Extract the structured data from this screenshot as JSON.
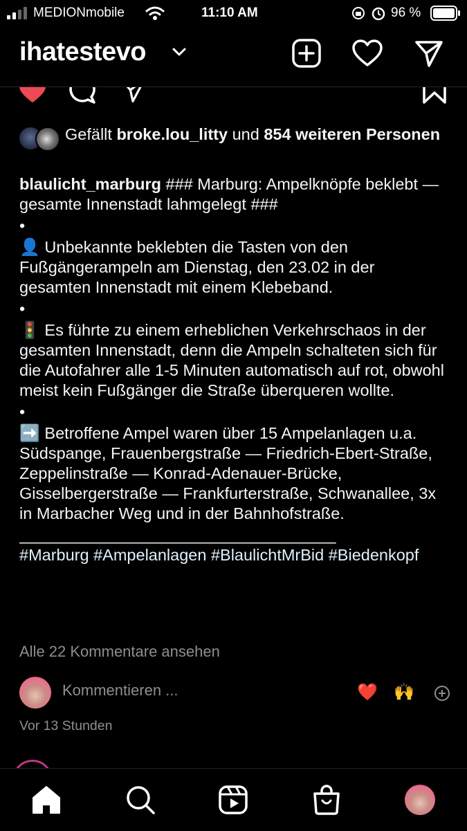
{
  "status_bar": {
    "carrier": "MEDIONmobile",
    "time": "11:10 AM",
    "battery": "96 %"
  },
  "header": {
    "account_name": "ihatestevo"
  },
  "post": {
    "likes": {
      "prefix": "Gefällt ",
      "user": "broke.lou_litty",
      "middle": " und ",
      "count": "854 weiteren Personen"
    },
    "username": "blaulicht_marburg",
    "headline": " ### Marburg: Ampelknöpfe beklebt — gesamte Innenstadt lahmgelegt ###",
    "dot": "•",
    "para1_emoji": "👤",
    "para1": " Unbekannte beklebten die Tasten von den Fußgängerampeln am Dienstag, den 23.02 in der gesamten Innenstadt mit einem Klebeband.",
    "para2_emoji": "🚦",
    "para2": " Es führte zu einem erheblichen Verkehrschaos in der gesamten Innenstadt, denn die Ampeln schalteten sich für die Autofahrer alle 1-5 Minuten automatisch auf rot, obwohl meist kein Fußgänger die Straße überqueren wollte.",
    "para3_emoji": "➡️",
    "para3": " Betroffene Ampel waren über 15 Ampelanlagen u.a. Südspange, Frauenbergstraße — Friedrich-Ebert-Straße, Zeppelinstraße — Konrad-Adenauer-Brücke, Gisselbergerstraße — Frankfurterstraße, Schwanallee, 3x in Marbacher Weg und in der Bahnhofstraße.",
    "separator": "___________________________________",
    "hashtags": "#Marburg #Ampelanlagen #BlaulichtMrBid #Biedenkopf",
    "view_comments": "Alle 22 Kommentare ansehen",
    "comment_placeholder": "Kommentieren ...",
    "quick_emoji_1": "❤️",
    "quick_emoji_2": "🙌",
    "time_ago": "Vor 13 Stunden"
  },
  "colors": {
    "background": "#000000",
    "text": "#f5f5f5",
    "muted": "#8e8e8e",
    "like_red": "#ed4956",
    "hashtag": "#e0f1ff"
  },
  "icons": {
    "header": [
      "new-post-icon",
      "heart-icon",
      "direct-message-icon"
    ],
    "nav": [
      "home-icon",
      "search-icon",
      "reels-icon",
      "shop-icon",
      "profile-avatar"
    ]
  }
}
